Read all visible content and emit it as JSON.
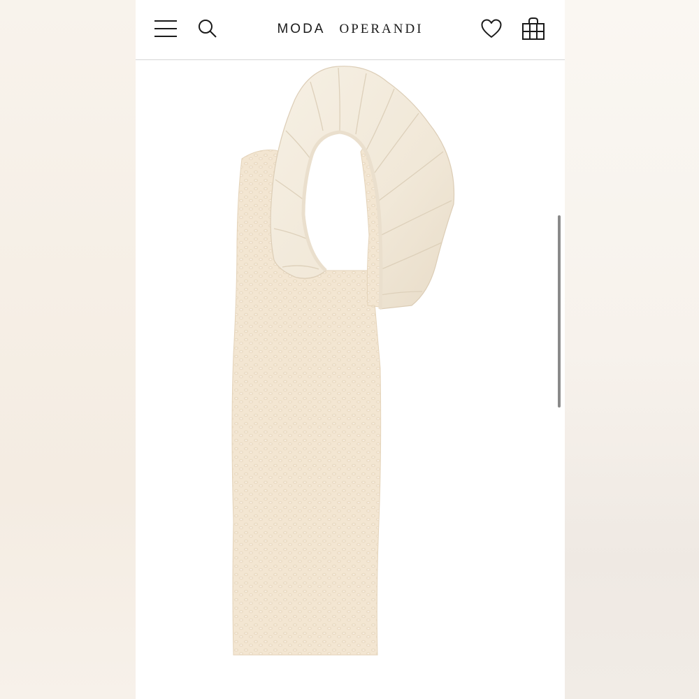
{
  "header": {
    "menu_icon": "hamburger-menu-icon",
    "search_icon": "search-icon",
    "wishlist_icon": "heart-icon",
    "bag_icon": "shopping-bag-icon",
    "logo": {
      "word1": "MODA",
      "word2": "OPERANDI"
    }
  },
  "product": {
    "image_icon": "one-shoulder-ruffle-dress-image"
  },
  "colors": {
    "dress": "#f3e6d2",
    "ruffle": "#f4eddf",
    "text": "#1a1a1a"
  }
}
